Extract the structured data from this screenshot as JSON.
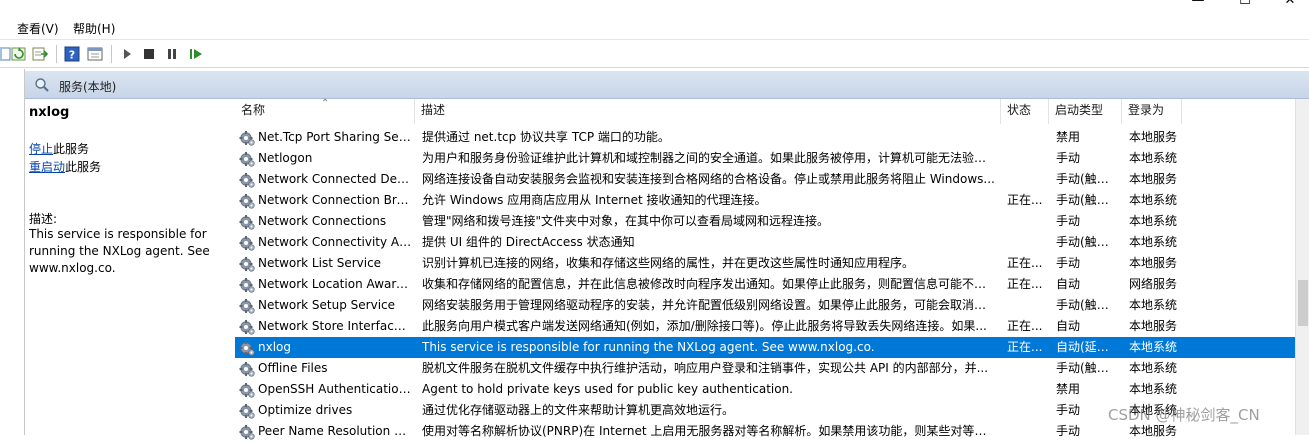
{
  "menus": [
    "查看(V)",
    "帮助(H)"
  ],
  "window_controls": [
    "—",
    "☐",
    "✕"
  ],
  "panel_title": "服务(本地)",
  "detail": {
    "service_name": "nxlog",
    "stop_link": "停止",
    "stop_suffix": "此服务",
    "restart_link": "重启动",
    "restart_suffix": "此服务",
    "desc_label": "描述:",
    "desc_text": "This service is responsible for running the NXLog agent. See www.nxlog.co."
  },
  "columns": [
    "名称",
    "描述",
    "状态",
    "启动类型",
    "登录为"
  ],
  "rows": [
    {
      "name": "Net.Tcp Port Sharing Ser...",
      "desc": "提供通过 net.tcp 协议共享 TCP 端口的功能。",
      "status": "",
      "startup": "禁用",
      "logon": "本地服务"
    },
    {
      "name": "Netlogon",
      "desc": "为用户和服务身份验证维护此计算机和域控制器之间的安全通道。如果此服务被停用，计算机可能无法验证...",
      "status": "",
      "startup": "手动",
      "logon": "本地系统"
    },
    {
      "name": "Network Connected Devi...",
      "desc": "网络连接设备自动安装服务会监视和安装连接到合格网络的合格设备。停止或禁用此服务将阻止 Windows...",
      "status": "",
      "startup": "手动(触发...",
      "logon": "本地服务"
    },
    {
      "name": "Network Connection Bro...",
      "desc": "允许 Windows 应用商店应用从 Internet 接收通知的代理连接。",
      "status": "正在...",
      "startup": "手动(触发...",
      "logon": "本地系统"
    },
    {
      "name": "Network Connections",
      "desc": "管理\"网络和拨号连接\"文件夹中对象，在其中你可以查看局域网和远程连接。",
      "status": "",
      "startup": "手动",
      "logon": "本地系统"
    },
    {
      "name": "Network Connectivity Ass...",
      "desc": "提供 UI 组件的 DirectAccess 状态通知",
      "status": "",
      "startup": "手动(触发...",
      "logon": "本地系统"
    },
    {
      "name": "Network List Service",
      "desc": "识别计算机已连接的网络，收集和存储这些网络的属性，并在更改这些属性时通知应用程序。",
      "status": "正在...",
      "startup": "手动",
      "logon": "本地服务"
    },
    {
      "name": "Network Location Aware...",
      "desc": "收集和存储网络的配置信息，并在此信息被修改时向程序发出通知。如果停止此服务，则配置信息可能不可...",
      "status": "正在...",
      "startup": "自动",
      "logon": "网络服务"
    },
    {
      "name": "Network Setup Service",
      "desc": "网络安装服务用于管理网络驱动程序的安装，并允许配置低级别网络设置。如果停止此服务，可能会取消正...",
      "status": "",
      "startup": "手动(触发...",
      "logon": "本地系统"
    },
    {
      "name": "Network Store Interface ...",
      "desc": "此服务向用户模式客户端发送网络通知(例如，添加/删除接口等)。停止此服务将导致丢失网络连接。如果...",
      "status": "正在...",
      "startup": "自动",
      "logon": "本地服务"
    },
    {
      "name": "nxlog",
      "desc": "This service is responsible for running the NXLog agent. See www.nxlog.co.",
      "status": "正在...",
      "startup": "自动(延迟...",
      "logon": "本地系统",
      "selected": true
    },
    {
      "name": "Offline Files",
      "desc": "脱机文件服务在脱机文件缓存中执行维护活动，响应用户登录和注销事件，实现公共 API 的内部部分，并...",
      "status": "",
      "startup": "手动(触发...",
      "logon": "本地系统"
    },
    {
      "name": "OpenSSH Authentication ...",
      "desc": "Agent to hold private keys used for public key authentication.",
      "status": "",
      "startup": "禁用",
      "logon": "本地系统"
    },
    {
      "name": "Optimize drives",
      "desc": "通过优化存储驱动器上的文件来帮助计算机更高效地运行。",
      "status": "",
      "startup": "手动",
      "logon": "本地系统"
    },
    {
      "name": "Peer Name Resolution Pr...",
      "desc": "使用对等名称解析协议(PNRP)在 Internet 上启用无服务器对等名称解析。如果禁用该功能，则某些对等应...",
      "status": "",
      "startup": "手动",
      "logon": "本地服务"
    }
  ],
  "watermark": "CSDN @神秘剑客_CN"
}
